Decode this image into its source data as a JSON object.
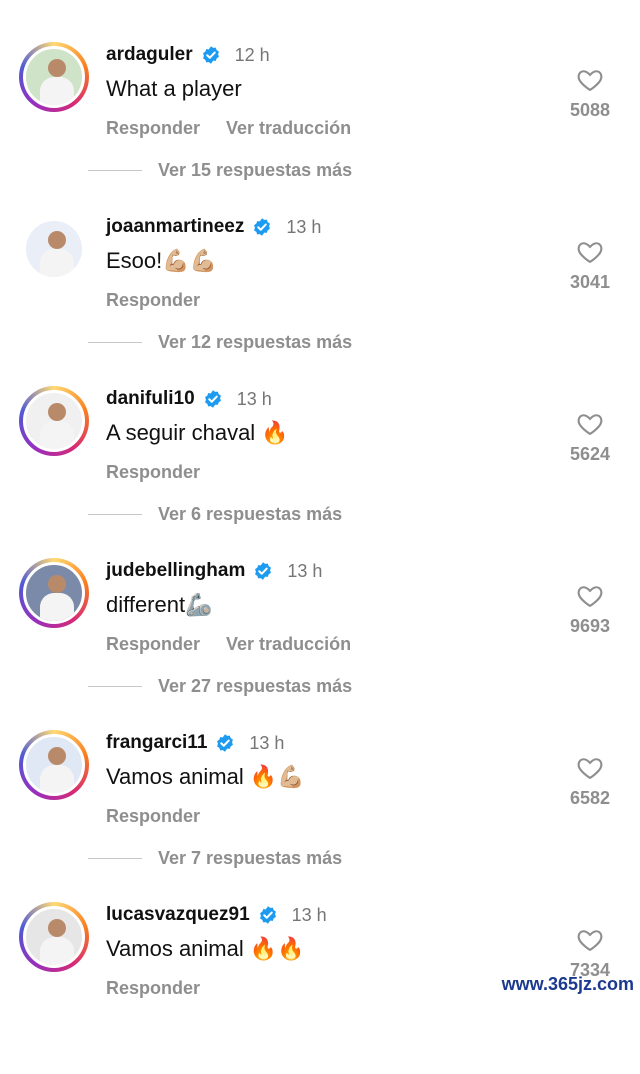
{
  "comments": [
    {
      "username": "ardaguler",
      "time": "12 h",
      "text": "What a player",
      "actions": [
        "Responder",
        "Ver traducción"
      ],
      "more": "Ver 15 respuestas más",
      "likes": "5088",
      "ring": true
    },
    {
      "username": "joaanmartineez",
      "time": "13 h",
      "text": "Esoo!💪🏼💪🏼",
      "actions": [
        "Responder"
      ],
      "more": "Ver 12 respuestas más",
      "likes": "3041",
      "ring": false
    },
    {
      "username": "danifuli10",
      "time": "13 h",
      "text": "A seguir chaval 🔥",
      "actions": [
        "Responder"
      ],
      "more": "Ver 6 respuestas más",
      "likes": "5624",
      "ring": true
    },
    {
      "username": "judebellingham",
      "time": "13 h",
      "text": "different🦾",
      "actions": [
        "Responder",
        "Ver traducción"
      ],
      "more": "Ver 27 respuestas más",
      "likes": "9693",
      "ring": true
    },
    {
      "username": "frangarci11",
      "time": "13 h",
      "text": "Vamos animal 🔥💪🏼",
      "actions": [
        "Responder"
      ],
      "more": "Ver 7 respuestas más",
      "likes": "6582",
      "ring": true
    },
    {
      "username": "lucasvazquez91",
      "time": "13 h",
      "text": "Vamos animal 🔥🔥",
      "actions": [
        "Responder"
      ],
      "more": "",
      "likes": "7334",
      "ring": true
    }
  ],
  "watermark": "www.365jz.com",
  "colors": {
    "verified": "#1d9bf0",
    "muted": "#8e8e8e",
    "text": "#111111"
  },
  "icons": {
    "verified": "verified-badge-icon",
    "like": "heart-outline-icon"
  }
}
